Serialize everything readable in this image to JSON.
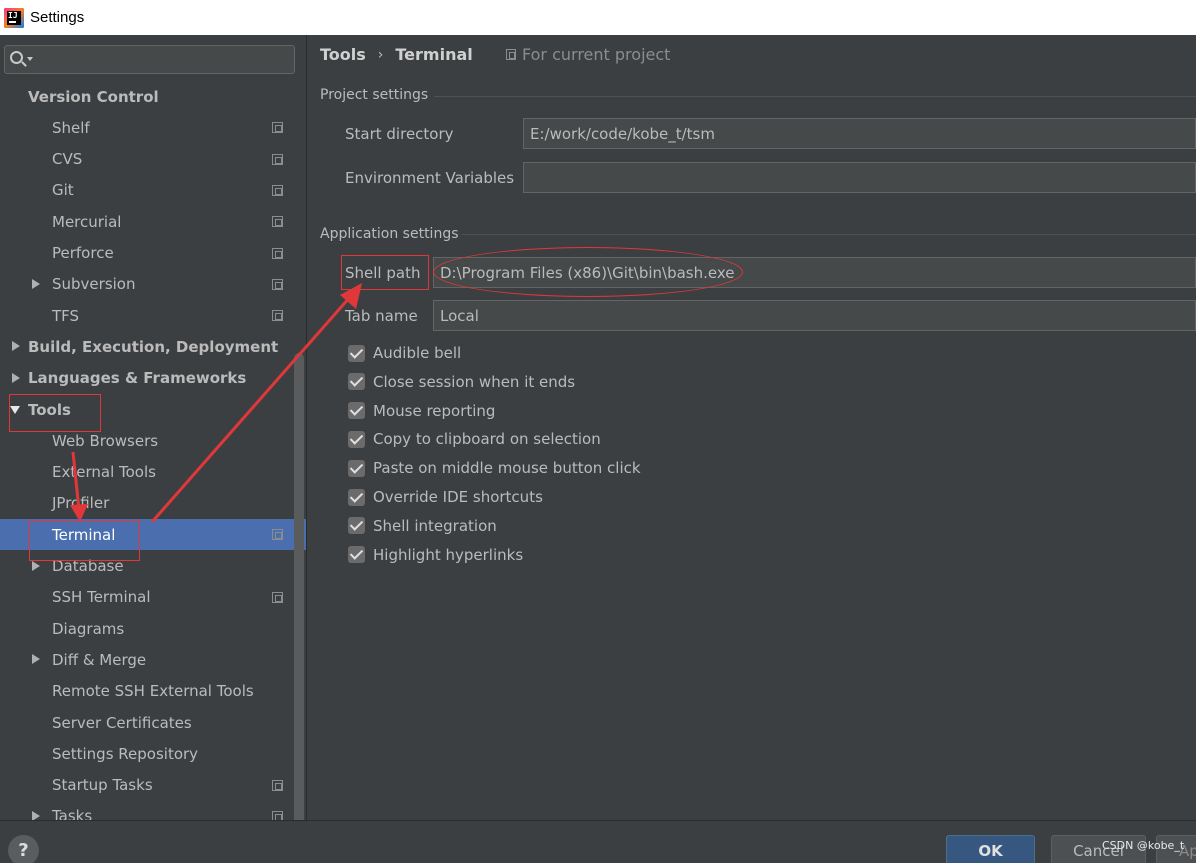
{
  "window": {
    "title": "Settings"
  },
  "search": {
    "placeholder": ""
  },
  "sidebar": {
    "items": [
      {
        "label": "Version Control",
        "level": 0,
        "bold": true,
        "expander": "none",
        "project_icon": false
      },
      {
        "label": "Shelf",
        "level": 1,
        "bold": false,
        "expander": "none",
        "project_icon": true
      },
      {
        "label": "CVS",
        "level": 1,
        "bold": false,
        "expander": "none",
        "project_icon": true
      },
      {
        "label": "Git",
        "level": 1,
        "bold": false,
        "expander": "none",
        "project_icon": true
      },
      {
        "label": "Mercurial",
        "level": 1,
        "bold": false,
        "expander": "none",
        "project_icon": true
      },
      {
        "label": "Perforce",
        "level": 1,
        "bold": false,
        "expander": "none",
        "project_icon": true
      },
      {
        "label": "Subversion",
        "level": 1,
        "bold": false,
        "expander": "collapsed",
        "project_icon": true
      },
      {
        "label": "TFS",
        "level": 1,
        "bold": false,
        "expander": "none",
        "project_icon": true
      },
      {
        "label": "Build, Execution, Deployment",
        "level": 0,
        "bold": true,
        "expander": "collapsed",
        "project_icon": false
      },
      {
        "label": "Languages & Frameworks",
        "level": 0,
        "bold": true,
        "expander": "collapsed",
        "project_icon": false
      },
      {
        "label": "Tools",
        "level": 0,
        "bold": true,
        "expander": "expanded",
        "project_icon": false
      },
      {
        "label": "Web Browsers",
        "level": 1,
        "bold": false,
        "expander": "none",
        "project_icon": false
      },
      {
        "label": "External Tools",
        "level": 1,
        "bold": false,
        "expander": "none",
        "project_icon": false
      },
      {
        "label": "JProfiler",
        "level": 1,
        "bold": false,
        "expander": "none",
        "project_icon": false
      },
      {
        "label": "Terminal",
        "level": 1,
        "bold": false,
        "expander": "none",
        "project_icon": true,
        "selected": true
      },
      {
        "label": "Database",
        "level": 1,
        "bold": false,
        "expander": "collapsed",
        "project_icon": false
      },
      {
        "label": "SSH Terminal",
        "level": 1,
        "bold": false,
        "expander": "none",
        "project_icon": true
      },
      {
        "label": "Diagrams",
        "level": 1,
        "bold": false,
        "expander": "none",
        "project_icon": false
      },
      {
        "label": "Diff & Merge",
        "level": 1,
        "bold": false,
        "expander": "collapsed",
        "project_icon": false
      },
      {
        "label": "Remote SSH External Tools",
        "level": 1,
        "bold": false,
        "expander": "none",
        "project_icon": false
      },
      {
        "label": "Server Certificates",
        "level": 1,
        "bold": false,
        "expander": "none",
        "project_icon": false
      },
      {
        "label": "Settings Repository",
        "level": 1,
        "bold": false,
        "expander": "none",
        "project_icon": false
      },
      {
        "label": "Startup Tasks",
        "level": 1,
        "bold": false,
        "expander": "none",
        "project_icon": true
      },
      {
        "label": "Tasks",
        "level": 1,
        "bold": false,
        "expander": "collapsed",
        "project_icon": true
      }
    ]
  },
  "header": {
    "breadcrumb_root": "Tools",
    "breadcrumb_sep": "›",
    "breadcrumb_current": "Terminal",
    "scope_label": "For current project"
  },
  "project_settings": {
    "title": "Project settings",
    "start_directory_label": "Start directory",
    "start_directory_value": "E:/work/code/kobe_t/tsm",
    "env_vars_label": "Environment Variables",
    "env_vars_value": ""
  },
  "app_settings": {
    "title": "Application settings",
    "shell_path_label": "Shell path",
    "shell_path_value": "D:\\Program Files (x86)\\Git\\bin\\bash.exe",
    "tab_name_label": "Tab name",
    "tab_name_value": "Local",
    "checkboxes": [
      {
        "label": "Audible bell",
        "checked": true
      },
      {
        "label": "Close session when it ends",
        "checked": true
      },
      {
        "label": "Mouse reporting",
        "checked": true
      },
      {
        "label": "Copy to clipboard on selection",
        "checked": true
      },
      {
        "label": "Paste on middle mouse button click",
        "checked": true
      },
      {
        "label": "Override IDE shortcuts",
        "checked": true
      },
      {
        "label": "Shell integration",
        "checked": true
      },
      {
        "label": "Highlight hyperlinks",
        "checked": true
      }
    ]
  },
  "footer": {
    "help_label": "?",
    "ok_label": "OK",
    "cancel_label": "Cancel",
    "apply_label": "Ap",
    "watermark": "CSDN @kobe_t"
  },
  "colors": {
    "background": "#3c3f41",
    "selection": "#4b6eaf",
    "annotation_red": "#e0383a",
    "ok_button": "#365880"
  }
}
